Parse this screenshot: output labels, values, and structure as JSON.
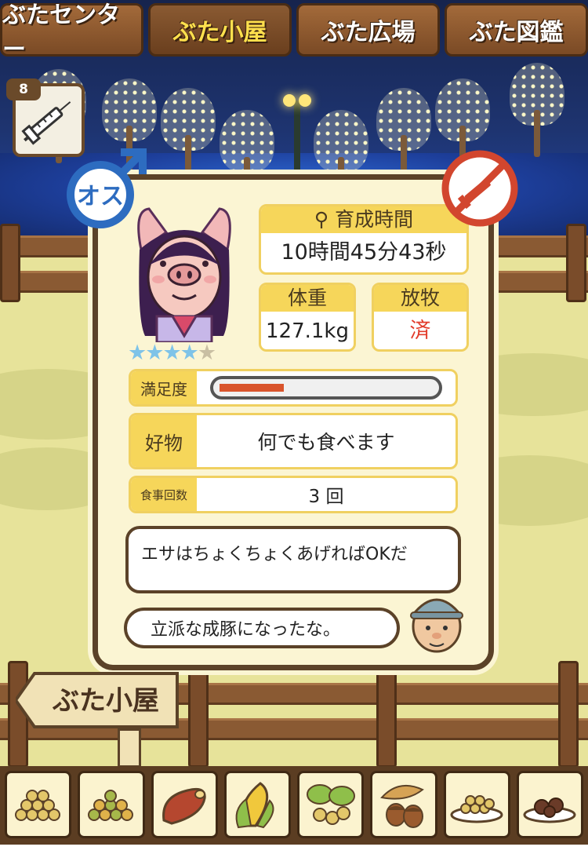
{
  "tabs": [
    {
      "label": "ぶたセンター",
      "active": false
    },
    {
      "label": "ぶた小屋",
      "active": true
    },
    {
      "label": "ぶた広場",
      "active": false
    },
    {
      "label": "ぶた図鑑",
      "active": false
    }
  ],
  "item": {
    "count": "8",
    "icon": "syringe-icon"
  },
  "pig": {
    "sex_label": "オス",
    "stars_on": 4,
    "stars_total": 5,
    "growth_time_label": "育成時間",
    "growth_time_value": "10時間45分43秒",
    "weight_label": "体重",
    "weight_value": "127.1kg",
    "grazing_label": "放牧",
    "grazing_value": "済",
    "satisfaction_label": "満足度",
    "satisfaction_level": 0.3,
    "favorite_label": "好物",
    "favorite_value": "何でも食べます",
    "meals_label": "食事回数",
    "meals_value": "3 回"
  },
  "dialog": {
    "line1": "エサはちょくちょくあげればOKだ",
    "line2": "立派な成豚になったな。"
  },
  "sign_text": "ぶた小屋",
  "food_items": [
    "soybeans-icon",
    "mixed-grain-icon",
    "sweet-potato-icon",
    "corn-icon",
    "vegetable-mix-icon",
    "acorn-icon",
    "grain-plate-icon",
    "meatball-plate-icon"
  ],
  "colors": {
    "accent": "#f6d65a",
    "frame": "#5b4228",
    "bar_fill": "#d9542c",
    "grazing_done": "#e23b2a"
  }
}
